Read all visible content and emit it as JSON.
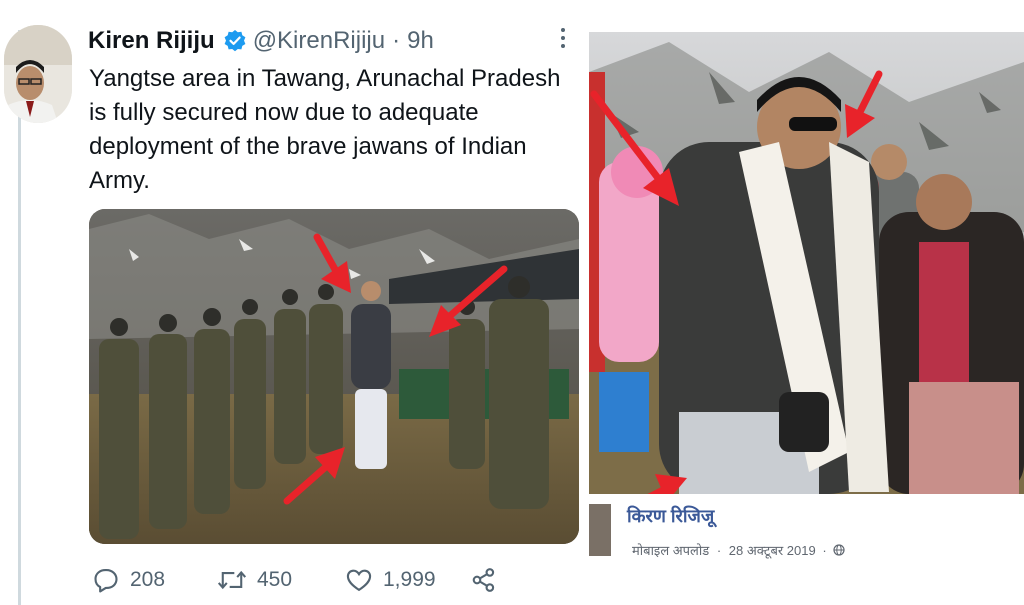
{
  "tweet": {
    "author_name": "Kiren Rijiju",
    "handle": "@KirenRijiju",
    "separator": "·",
    "time": "9h",
    "text": "Yangtse area in Tawang, Arunachal Pradesh is fully secured now due to adequate deployment of the brave jawans of Indian Army.",
    "stats": {
      "replies": "208",
      "retweets": "450",
      "likes": "1,999"
    }
  },
  "facebook_post": {
    "author_name": "किरण रिजिजू",
    "upload_type": "मोबाइल अपलोड",
    "date": "28 अक्टूबर 2019",
    "separator": "·"
  },
  "colors": {
    "verified": "#1d9bf0",
    "arrow": "#e8232a",
    "text_muted": "#536471",
    "fb_link": "#3b5998"
  },
  "icons": [
    "verified-badge-icon",
    "more-options-icon",
    "reply-icon",
    "retweet-icon",
    "like-icon",
    "share-icon",
    "globe-icon",
    "red-arrow-annotation"
  ]
}
